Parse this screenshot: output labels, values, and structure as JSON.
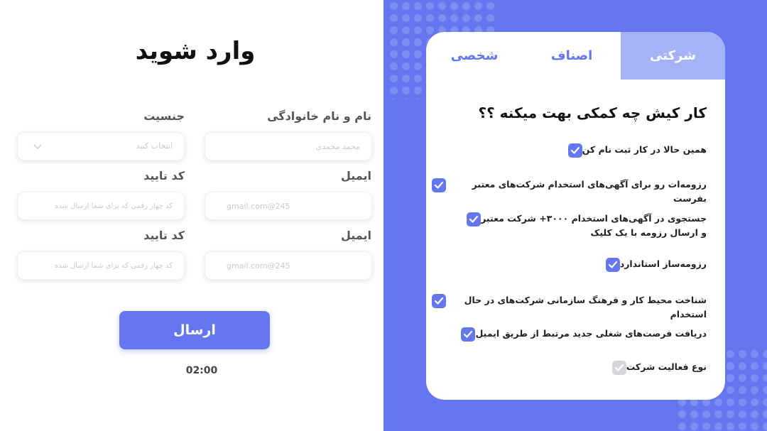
{
  "login": {
    "title": "وارد شوید",
    "fields": {
      "name": {
        "label": "نام و نام خانوادگی",
        "placeholder": "محمد محمدی"
      },
      "gender": {
        "label": "جنسیت",
        "placeholder": "انتخاب کنید"
      },
      "email1": {
        "label": "ایمیل",
        "placeholder": "245@gmail.com"
      },
      "code1": {
        "label": "کد تایید",
        "placeholder": "کد چهار رقمی که برای شما ارسال شده"
      },
      "email2": {
        "label": "ایمیل",
        "placeholder": "245@gmail.com"
      },
      "code2": {
        "label": "کد تایید",
        "placeholder": "کد چهار رقمی که برای شما ارسال شده"
      }
    },
    "submit_label": "ارسال",
    "timer": "02:00"
  },
  "panel": {
    "tabs": [
      {
        "label": "شرکتی",
        "active": true
      },
      {
        "label": "اصناف",
        "active": false
      },
      {
        "label": "شخصی",
        "active": false
      }
    ],
    "heading": "کار کیش چه کمکی بهت میکنه ؟؟",
    "features": [
      {
        "text": "همین حالا در کار ثبت نام کن",
        "checked": true
      },
      {
        "text": "رزومه‌ات رو برای آگهی‌های استخدام شرکت‌های معتبر بفرست",
        "checked": true
      },
      {
        "text": "جستجوی در آگهی‌های استخدام ۳۰۰۰+ شرکت معتبر\nو ارسال رزومه با یک کلیک",
        "checked": true
      },
      {
        "text": "رزومه‌ساز استاندارد",
        "checked": true
      },
      {
        "text": "شناخت محیط کار و فرهنگ سازمانی شرکت‌های در حال استخدام",
        "checked": true
      },
      {
        "text": "دریافت فرصت‌های شغلی جدید مرتبط از طریق ایمیل",
        "checked": true
      },
      {
        "text": "نوع فعالیت شرکت",
        "checked": false
      }
    ]
  },
  "colors": {
    "accent": "#6477f0",
    "tab_active": "#a5b2f6",
    "check_off": "#d6d6da"
  }
}
